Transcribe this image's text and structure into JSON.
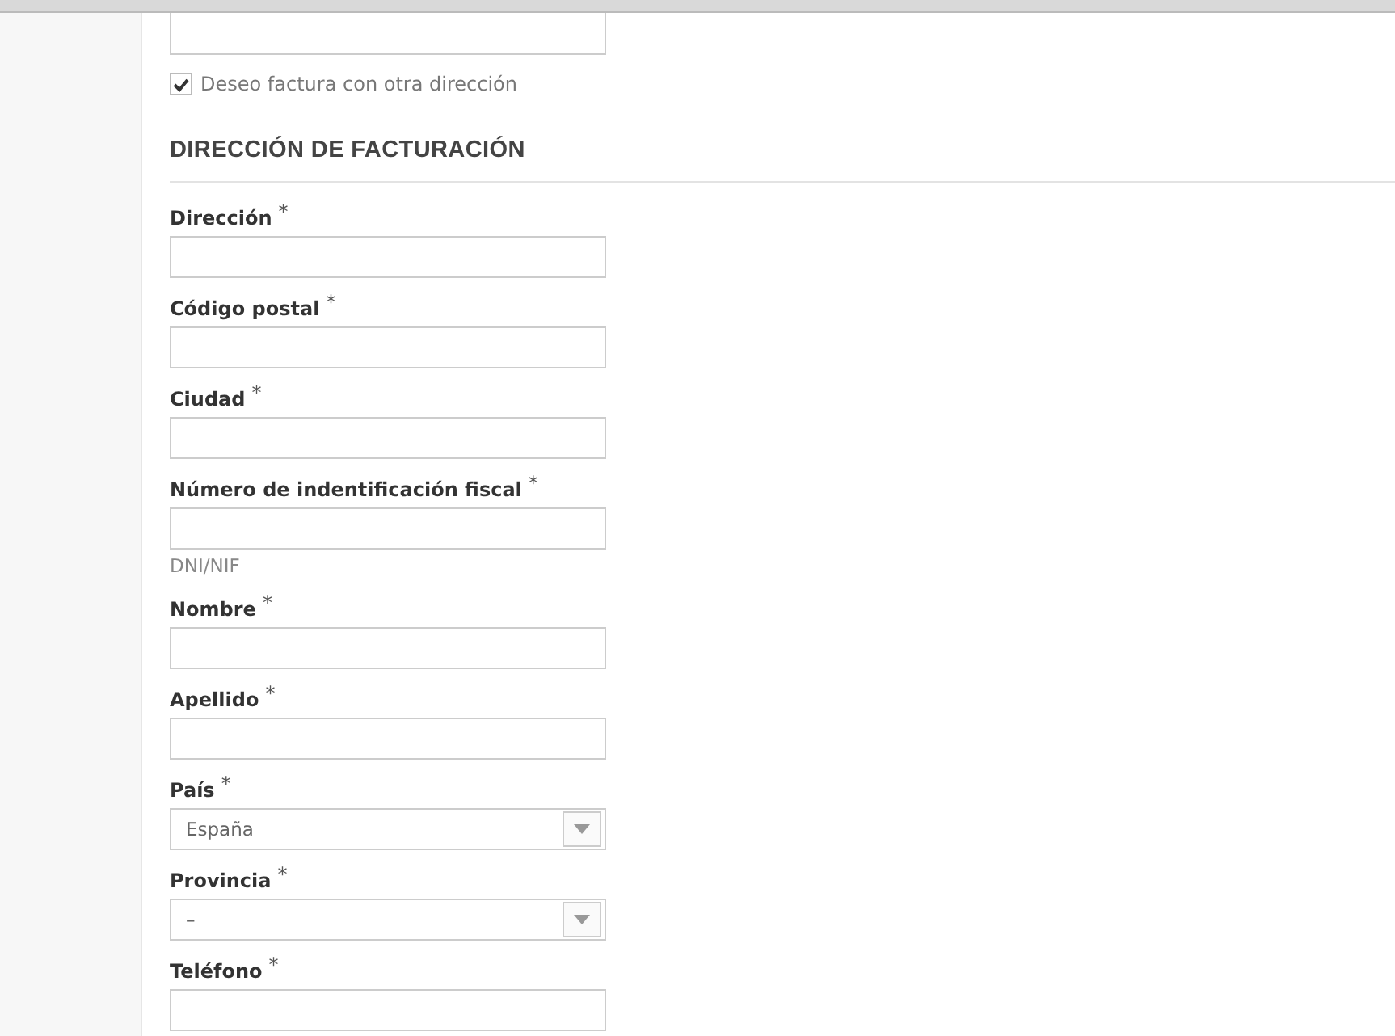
{
  "invoice_checkbox": {
    "label": "Deseo factura con otra dirección",
    "checked": true
  },
  "section_title": "DIRECCIÓN DE FACTURACIÓN",
  "fields": [
    {
      "label": "Dirección",
      "required_mark": "*",
      "kind": "text"
    },
    {
      "label": "Código postal",
      "required_mark": "*",
      "kind": "text"
    },
    {
      "label": "Ciudad",
      "required_mark": "*",
      "kind": "text"
    },
    {
      "label": "Número de indentificación fiscal",
      "required_mark": "*",
      "kind": "text",
      "hint": "DNI/NIF"
    },
    {
      "label": "Nombre",
      "required_mark": "*",
      "kind": "text"
    },
    {
      "label": "Apellido",
      "required_mark": "*",
      "kind": "text"
    },
    {
      "label": "País",
      "required_mark": "*",
      "kind": "select",
      "value": "España"
    },
    {
      "label": "Provincia",
      "required_mark": "*",
      "kind": "select",
      "value": "–"
    },
    {
      "label": "Teléfono",
      "required_mark": "*",
      "kind": "text"
    }
  ]
}
